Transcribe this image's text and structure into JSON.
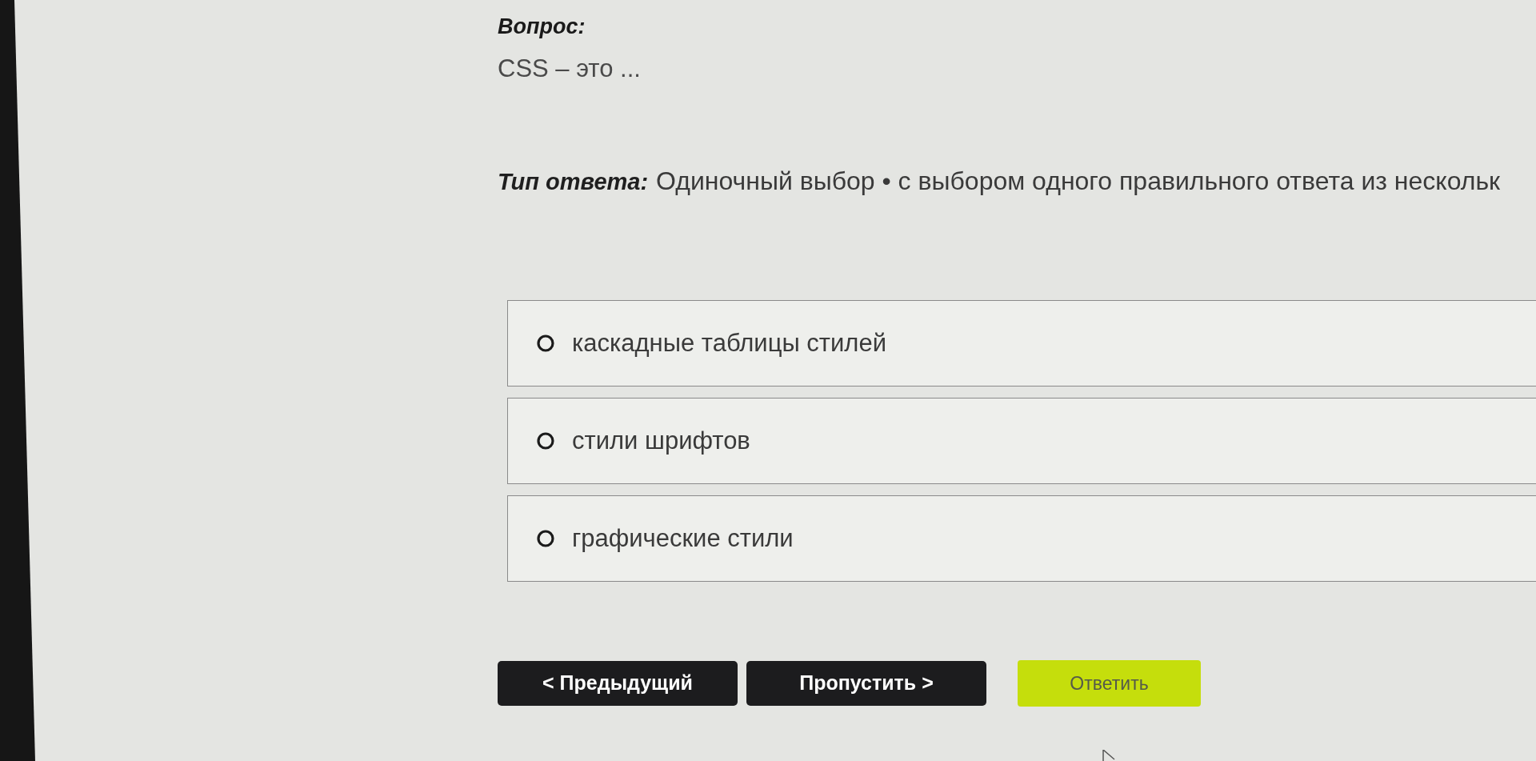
{
  "question": {
    "label": "Вопрос:",
    "text": "CSS – это ..."
  },
  "answer_type": {
    "label": "Тип ответа:",
    "value": "Одиночный выбор • с выбором одного правильного ответа из нескольк"
  },
  "options": [
    {
      "text": "каскадные таблицы стилей",
      "selected": false
    },
    {
      "text": "стили шрифтов",
      "selected": false
    },
    {
      "text": "графические стили",
      "selected": false
    }
  ],
  "buttons": [
    {
      "label": "< Предыдущий",
      "kind": "secondary"
    },
    {
      "label": "Пропустить >",
      "kind": "secondary"
    },
    {
      "label": "Ответить",
      "kind": "primary"
    }
  ]
}
